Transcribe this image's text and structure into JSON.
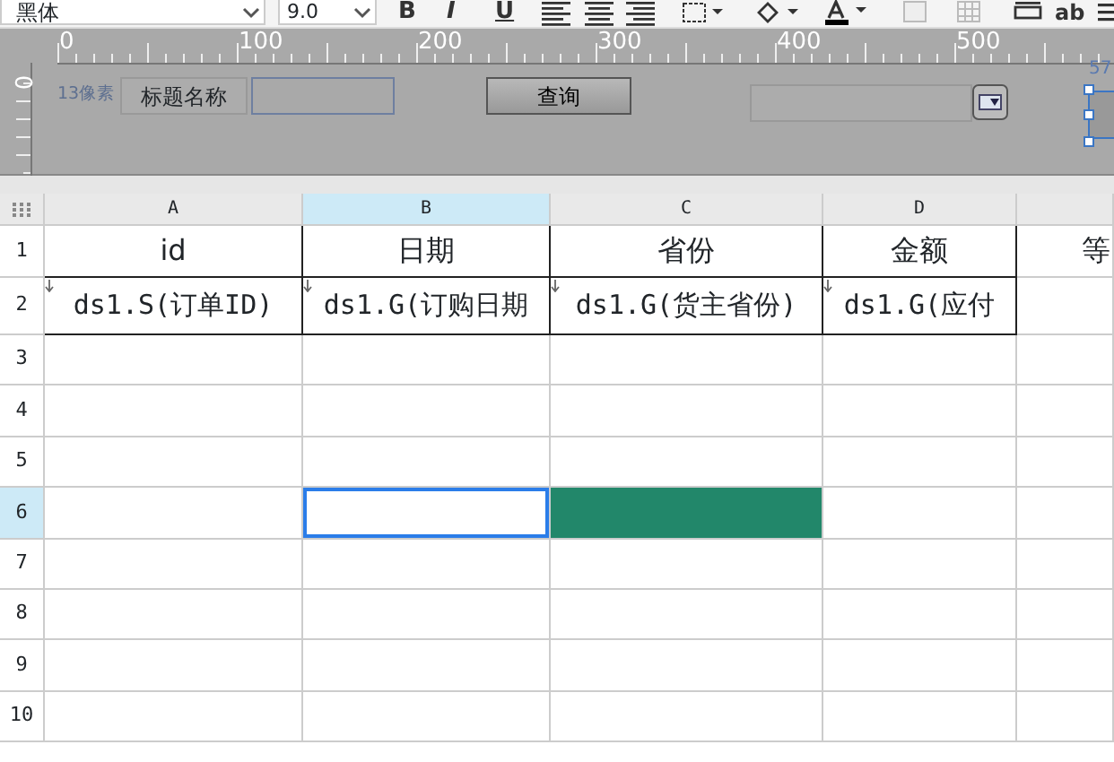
{
  "toolbar": {
    "font": "黑体",
    "font_size": "9.0",
    "style_buttons": [
      "B",
      "I",
      "U"
    ],
    "text_button": "ab"
  },
  "ruler": {
    "marks": [
      "0",
      "100",
      "200",
      "300",
      "400",
      "500"
    ],
    "vertical_mark": "0"
  },
  "parameter_panel": {
    "height_label": "13像素",
    "title_label": "标题名称",
    "query_button": "查询",
    "widget_label": "57"
  },
  "sheet": {
    "columns": [
      {
        "label": "A",
        "selected": false
      },
      {
        "label": "B",
        "selected": true
      },
      {
        "label": "C",
        "selected": false
      },
      {
        "label": "D",
        "selected": false
      },
      {
        "selected": false
      }
    ],
    "rows": [
      {
        "number": "1",
        "selected": false,
        "cells": [
          {
            "kind": "header",
            "text": "id",
            "selected": false
          },
          {
            "kind": "header",
            "text": "日期",
            "selected": false
          },
          {
            "kind": "header",
            "text": "省份",
            "selected": false
          },
          {
            "kind": "header",
            "text": "金额",
            "selected": false
          },
          {
            "kind": "header",
            "text": "等",
            "selected": false
          }
        ]
      },
      {
        "number": "2",
        "selected": false,
        "cells": [
          {
            "kind": "data",
            "text": "ds1.S(订单ID)",
            "expand": true,
            "selected": false
          },
          {
            "kind": "data",
            "text": "ds1.G(订购日期",
            "expand": true,
            "selected": false
          },
          {
            "kind": "data",
            "text": "ds1.G(货主省份)",
            "expand": true,
            "selected": false
          },
          {
            "kind": "data",
            "text": "ds1.G(应付",
            "expand": true,
            "selected": false
          },
          {
            "kind": "data",
            "selected": false
          }
        ]
      },
      {
        "number": "3",
        "selected": false,
        "cells": [
          {
            "selected": false
          },
          {
            "selected": false
          },
          {
            "selected": false
          },
          {
            "selected": false
          },
          {
            "selected": false
          }
        ]
      },
      {
        "number": "4",
        "selected": false,
        "cells": [
          {
            "selected": false
          },
          {
            "selected": false
          },
          {
            "selected": false
          },
          {
            "selected": false
          },
          {
            "selected": false
          }
        ]
      },
      {
        "number": "5",
        "selected": false,
        "cells": [
          {
            "selected": false
          },
          {
            "selected": false
          },
          {
            "selected": false
          },
          {
            "selected": false
          },
          {
            "selected": false
          }
        ]
      },
      {
        "number": "6",
        "selected": true,
        "cells": [
          {
            "selected": false
          },
          {
            "selected": true
          },
          {
            "selected": false,
            "color": "#22876a"
          },
          {
            "selected": false
          },
          {
            "selected": false
          }
        ]
      },
      {
        "number": "7",
        "selected": false,
        "cells": [
          {
            "selected": false
          },
          {
            "selected": false
          },
          {
            "selected": false
          },
          {
            "selected": false
          },
          {
            "selected": false
          }
        ]
      },
      {
        "number": "8",
        "selected": false,
        "cells": [
          {
            "selected": false
          },
          {
            "selected": false
          },
          {
            "selected": false
          },
          {
            "selected": false
          },
          {
            "selected": false
          }
        ]
      },
      {
        "number": "9",
        "selected": false,
        "cells": [
          {
            "selected": false
          },
          {
            "selected": false
          },
          {
            "selected": false
          },
          {
            "selected": false
          },
          {
            "selected": false
          }
        ]
      },
      {
        "number": "10",
        "selected": false,
        "cells": [
          {
            "selected": false
          },
          {
            "selected": false
          },
          {
            "selected": false
          },
          {
            "selected": false
          },
          {
            "selected": false
          }
        ]
      }
    ]
  }
}
